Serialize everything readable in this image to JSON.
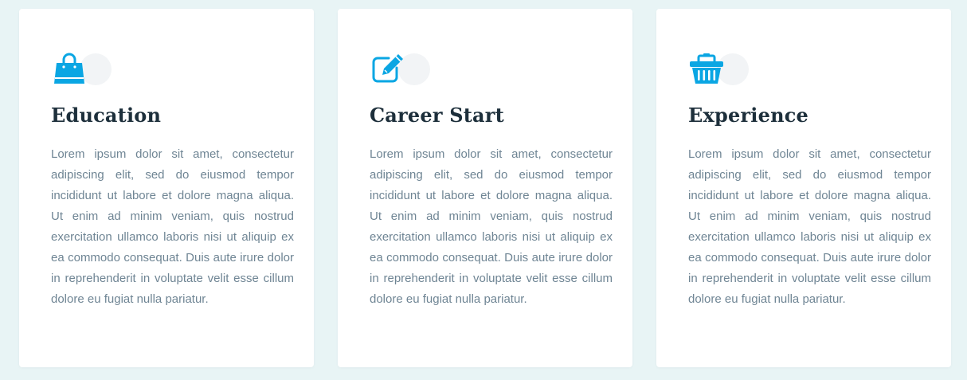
{
  "colors": {
    "page_background": "#e8f4f5",
    "card_background": "#ffffff",
    "accent": "#0aa6e3",
    "title": "#1d2f3b",
    "body_text": "#6f8594"
  },
  "cards": [
    {
      "icon": "shopping-bag-icon",
      "title": "Education",
      "text": "Lorem ipsum dolor sit amet, consectetur adipiscing elit, sed do eiusmod tempor incididunt ut labore et dolore magna aliqua. Ut enim ad minim veniam, quis nostrud exercitation ullamco laboris nisi ut aliquip ex ea commodo consequat. Duis aute irure dolor in reprehenderit in voluptate velit esse cillum dolore eu fugiat nulla pariatur."
    },
    {
      "icon": "edit-icon",
      "title": "Career Start",
      "text": "Lorem ipsum dolor sit amet, consectetur adipiscing elit, sed do eiusmod tempor incididunt ut labore et dolore magna aliqua. Ut enim ad minim veniam, quis nostrud exercitation ullamco laboris nisi ut aliquip ex ea commodo consequat. Duis aute irure dolor in reprehenderit in voluptate velit esse cillum dolore eu fugiat nulla pariatur."
    },
    {
      "icon": "shopping-basket-icon",
      "title": "Experience",
      "text": "Lorem ipsum dolor sit amet, consectetur adipiscing elit, sed do eiusmod tempor incididunt ut labore et dolore magna aliqua. Ut enim ad minim veniam, quis nostrud exercitation ullamco laboris nisi ut aliquip ex ea commodo consequat. Duis aute irure dolor in reprehenderit in voluptate velit esse cillum dolore eu fugiat nulla pariatur."
    }
  ]
}
